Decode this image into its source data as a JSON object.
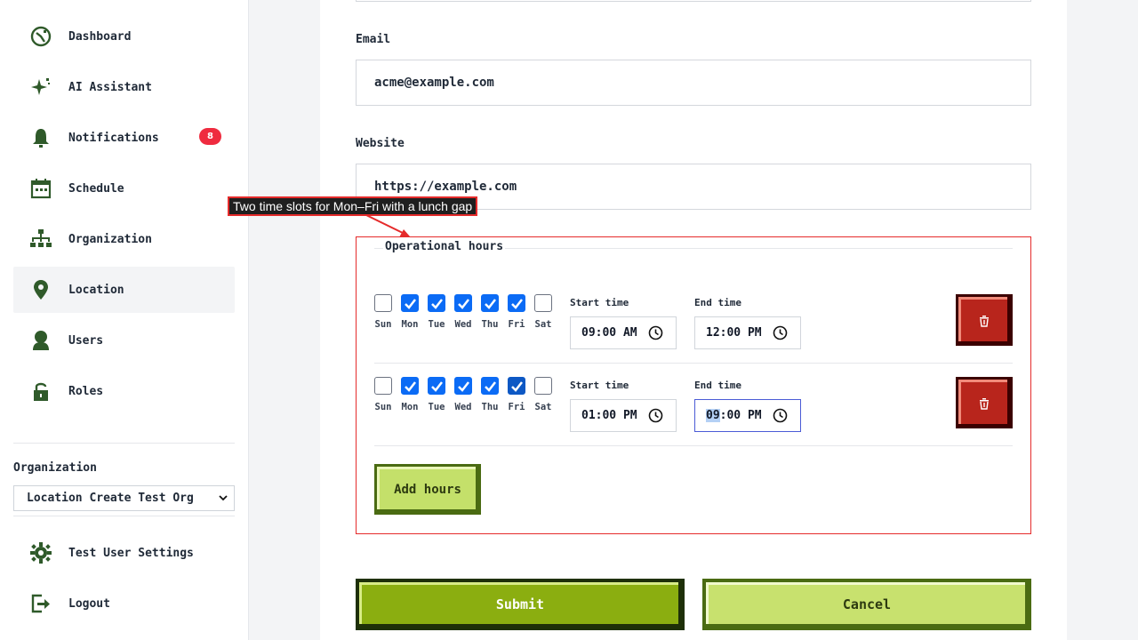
{
  "sidebar": {
    "items": [
      {
        "label": "Dashboard",
        "icon": "dashboard-icon"
      },
      {
        "label": "AI Assistant",
        "icon": "sparkle-icon"
      },
      {
        "label": "Notifications",
        "icon": "bell-icon",
        "badge": "8"
      },
      {
        "label": "Schedule",
        "icon": "calendar-icon"
      },
      {
        "label": "Organization",
        "icon": "org-chart-icon"
      },
      {
        "label": "Location",
        "icon": "location-pin-icon",
        "active": true
      },
      {
        "label": "Users",
        "icon": "user-icon"
      },
      {
        "label": "Roles",
        "icon": "lock-icon"
      }
    ],
    "organization": {
      "label": "Organization",
      "selected": "Location Create Test Org"
    },
    "footer": [
      {
        "label": "Test User Settings",
        "icon": "gear-icon"
      },
      {
        "label": "Logout",
        "icon": "logout-icon"
      }
    ]
  },
  "form": {
    "email": {
      "label": "Email",
      "value": "acme@example.com"
    },
    "website": {
      "label": "Website",
      "value": "https://example.com"
    },
    "hours": {
      "title": "Operational hours",
      "rows": [
        {
          "days": [
            {
              "label": "Sun",
              "checked": false
            },
            {
              "label": "Mon",
              "checked": true
            },
            {
              "label": "Tue",
              "checked": true
            },
            {
              "label": "Wed",
              "checked": true
            },
            {
              "label": "Thu",
              "checked": true
            },
            {
              "label": "Fri",
              "checked": true
            },
            {
              "label": "Sat",
              "checked": false
            }
          ],
          "start_label": "Start time",
          "start_value": "09:00 AM",
          "end_label": "End time",
          "end_value": "12:00 PM"
        },
        {
          "days": [
            {
              "label": "Sun",
              "checked": false
            },
            {
              "label": "Mon",
              "checked": true
            },
            {
              "label": "Tue",
              "checked": true
            },
            {
              "label": "Wed",
              "checked": true
            },
            {
              "label": "Thu",
              "checked": true
            },
            {
              "label": "Fri",
              "checked": true
            },
            {
              "label": "Sat",
              "checked": false
            }
          ],
          "start_label": "Start time",
          "start_value": "01:00 PM",
          "end_label": "End time",
          "end_value_selected": "09",
          "end_value_rest": ":00 PM"
        }
      ],
      "add_label": "Add hours"
    },
    "submit_label": "Submit",
    "cancel_label": "Cancel"
  },
  "annotation": {
    "text": "Two time slots for Mon–Fri with a lunch gap"
  },
  "colors": {
    "accent_red": "#e52b2b",
    "checkbox_blue": "#0b6bf5",
    "submit_green": "#8bae10",
    "cancel_green": "#c8e16e",
    "delete_red": "#b8251c"
  }
}
